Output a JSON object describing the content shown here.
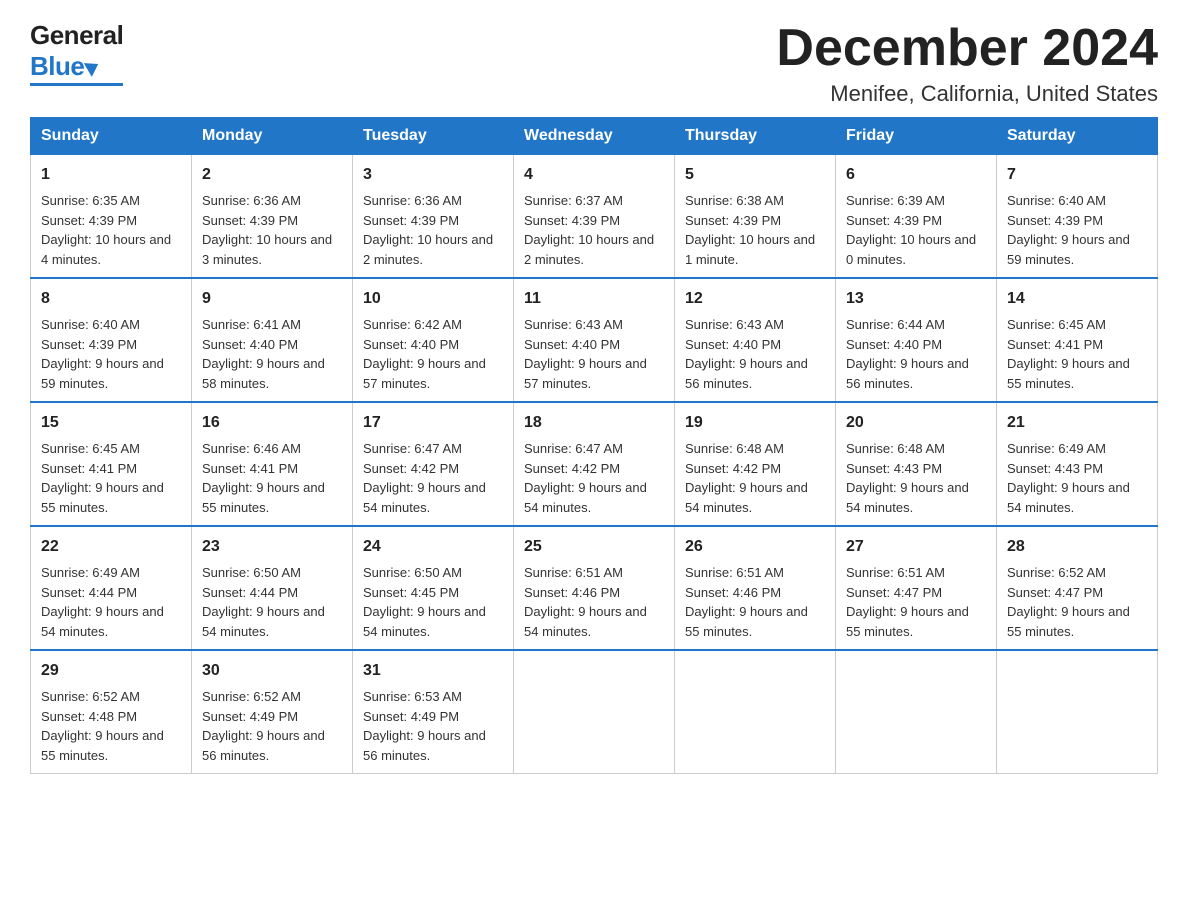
{
  "header": {
    "logo_general": "General",
    "logo_blue": "Blue",
    "month_title": "December 2024",
    "location": "Menifee, California, United States"
  },
  "days_of_week": [
    "Sunday",
    "Monday",
    "Tuesday",
    "Wednesday",
    "Thursday",
    "Friday",
    "Saturday"
  ],
  "weeks": [
    [
      {
        "day": "1",
        "sunrise": "6:35 AM",
        "sunset": "4:39 PM",
        "daylight": "10 hours and 4 minutes."
      },
      {
        "day": "2",
        "sunrise": "6:36 AM",
        "sunset": "4:39 PM",
        "daylight": "10 hours and 3 minutes."
      },
      {
        "day": "3",
        "sunrise": "6:36 AM",
        "sunset": "4:39 PM",
        "daylight": "10 hours and 2 minutes."
      },
      {
        "day": "4",
        "sunrise": "6:37 AM",
        "sunset": "4:39 PM",
        "daylight": "10 hours and 2 minutes."
      },
      {
        "day": "5",
        "sunrise": "6:38 AM",
        "sunset": "4:39 PM",
        "daylight": "10 hours and 1 minute."
      },
      {
        "day": "6",
        "sunrise": "6:39 AM",
        "sunset": "4:39 PM",
        "daylight": "10 hours and 0 minutes."
      },
      {
        "day": "7",
        "sunrise": "6:40 AM",
        "sunset": "4:39 PM",
        "daylight": "9 hours and 59 minutes."
      }
    ],
    [
      {
        "day": "8",
        "sunrise": "6:40 AM",
        "sunset": "4:39 PM",
        "daylight": "9 hours and 59 minutes."
      },
      {
        "day": "9",
        "sunrise": "6:41 AM",
        "sunset": "4:40 PM",
        "daylight": "9 hours and 58 minutes."
      },
      {
        "day": "10",
        "sunrise": "6:42 AM",
        "sunset": "4:40 PM",
        "daylight": "9 hours and 57 minutes."
      },
      {
        "day": "11",
        "sunrise": "6:43 AM",
        "sunset": "4:40 PM",
        "daylight": "9 hours and 57 minutes."
      },
      {
        "day": "12",
        "sunrise": "6:43 AM",
        "sunset": "4:40 PM",
        "daylight": "9 hours and 56 minutes."
      },
      {
        "day": "13",
        "sunrise": "6:44 AM",
        "sunset": "4:40 PM",
        "daylight": "9 hours and 56 minutes."
      },
      {
        "day": "14",
        "sunrise": "6:45 AM",
        "sunset": "4:41 PM",
        "daylight": "9 hours and 55 minutes."
      }
    ],
    [
      {
        "day": "15",
        "sunrise": "6:45 AM",
        "sunset": "4:41 PM",
        "daylight": "9 hours and 55 minutes."
      },
      {
        "day": "16",
        "sunrise": "6:46 AM",
        "sunset": "4:41 PM",
        "daylight": "9 hours and 55 minutes."
      },
      {
        "day": "17",
        "sunrise": "6:47 AM",
        "sunset": "4:42 PM",
        "daylight": "9 hours and 54 minutes."
      },
      {
        "day": "18",
        "sunrise": "6:47 AM",
        "sunset": "4:42 PM",
        "daylight": "9 hours and 54 minutes."
      },
      {
        "day": "19",
        "sunrise": "6:48 AM",
        "sunset": "4:42 PM",
        "daylight": "9 hours and 54 minutes."
      },
      {
        "day": "20",
        "sunrise": "6:48 AM",
        "sunset": "4:43 PM",
        "daylight": "9 hours and 54 minutes."
      },
      {
        "day": "21",
        "sunrise": "6:49 AM",
        "sunset": "4:43 PM",
        "daylight": "9 hours and 54 minutes."
      }
    ],
    [
      {
        "day": "22",
        "sunrise": "6:49 AM",
        "sunset": "4:44 PM",
        "daylight": "9 hours and 54 minutes."
      },
      {
        "day": "23",
        "sunrise": "6:50 AM",
        "sunset": "4:44 PM",
        "daylight": "9 hours and 54 minutes."
      },
      {
        "day": "24",
        "sunrise": "6:50 AM",
        "sunset": "4:45 PM",
        "daylight": "9 hours and 54 minutes."
      },
      {
        "day": "25",
        "sunrise": "6:51 AM",
        "sunset": "4:46 PM",
        "daylight": "9 hours and 54 minutes."
      },
      {
        "day": "26",
        "sunrise": "6:51 AM",
        "sunset": "4:46 PM",
        "daylight": "9 hours and 55 minutes."
      },
      {
        "day": "27",
        "sunrise": "6:51 AM",
        "sunset": "4:47 PM",
        "daylight": "9 hours and 55 minutes."
      },
      {
        "day": "28",
        "sunrise": "6:52 AM",
        "sunset": "4:47 PM",
        "daylight": "9 hours and 55 minutes."
      }
    ],
    [
      {
        "day": "29",
        "sunrise": "6:52 AM",
        "sunset": "4:48 PM",
        "daylight": "9 hours and 55 minutes."
      },
      {
        "day": "30",
        "sunrise": "6:52 AM",
        "sunset": "4:49 PM",
        "daylight": "9 hours and 56 minutes."
      },
      {
        "day": "31",
        "sunrise": "6:53 AM",
        "sunset": "4:49 PM",
        "daylight": "9 hours and 56 minutes."
      },
      null,
      null,
      null,
      null
    ]
  ],
  "labels": {
    "sunrise": "Sunrise:",
    "sunset": "Sunset:",
    "daylight": "Daylight:"
  },
  "colors": {
    "header_bg": "#2176c7",
    "header_text": "#ffffff",
    "border": "#ccc",
    "accent": "#2176c7"
  }
}
